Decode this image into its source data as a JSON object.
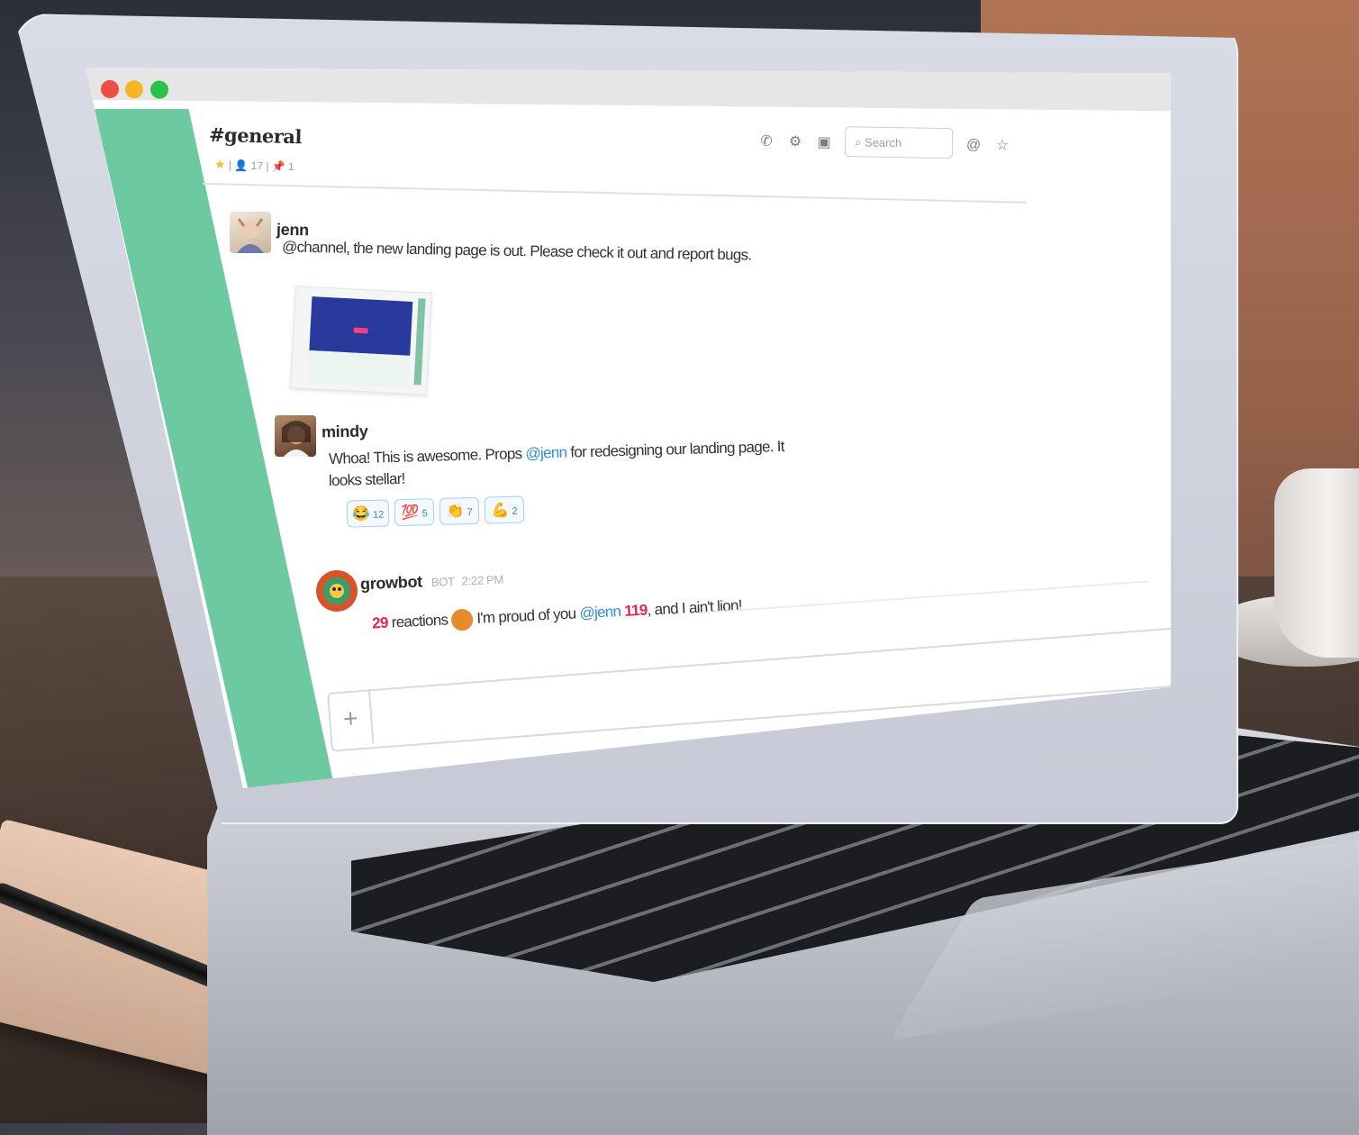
{
  "window": {
    "traffic_lights": [
      "close",
      "minimize",
      "maximize"
    ]
  },
  "channel": {
    "name": "#general",
    "members": "17",
    "pins": "1",
    "icons": [
      "star-icon",
      "members-icon",
      "pin-icon"
    ]
  },
  "header_tools": {
    "icons": [
      "phone-icon",
      "gear-icon",
      "sidebar-toggle-icon",
      "search-icon",
      "at-mention-icon",
      "star-outline-icon"
    ],
    "search_placeholder": "Search"
  },
  "messages": [
    {
      "user": "jenn",
      "text_prefix": "@channel",
      "text": ", the new landing page is out. Please check it out and report bugs.",
      "attachment": "landing-page-preview"
    },
    {
      "user": "mindy",
      "text_before": "Whoa! This is awesome. Props ",
      "mention": "@jenn",
      "text_after": " for redesigning our landing page. It",
      "text_line2": "looks stellar!",
      "reactions": [
        {
          "emoji": "😂",
          "count": "12"
        },
        {
          "emoji": "💯",
          "count": "5"
        },
        {
          "emoji": "👏",
          "count": "7"
        },
        {
          "emoji": "💪",
          "count": "2"
        }
      ]
    },
    {
      "user": "growbot",
      "tag": "BOT",
      "time": "2:22 PM",
      "count_red": "29",
      "reactions_word": "reactions",
      "text_before": "I'm proud of you ",
      "mention": "@jenn",
      "count_red2": "119",
      "text_after": ", and I ain't lion!"
    }
  ],
  "composer": {
    "plus_label": "+"
  },
  "colors": {
    "sidebar": "#6cc9a0",
    "mention": "#2e8fd8",
    "highlight": "#e0245e"
  }
}
